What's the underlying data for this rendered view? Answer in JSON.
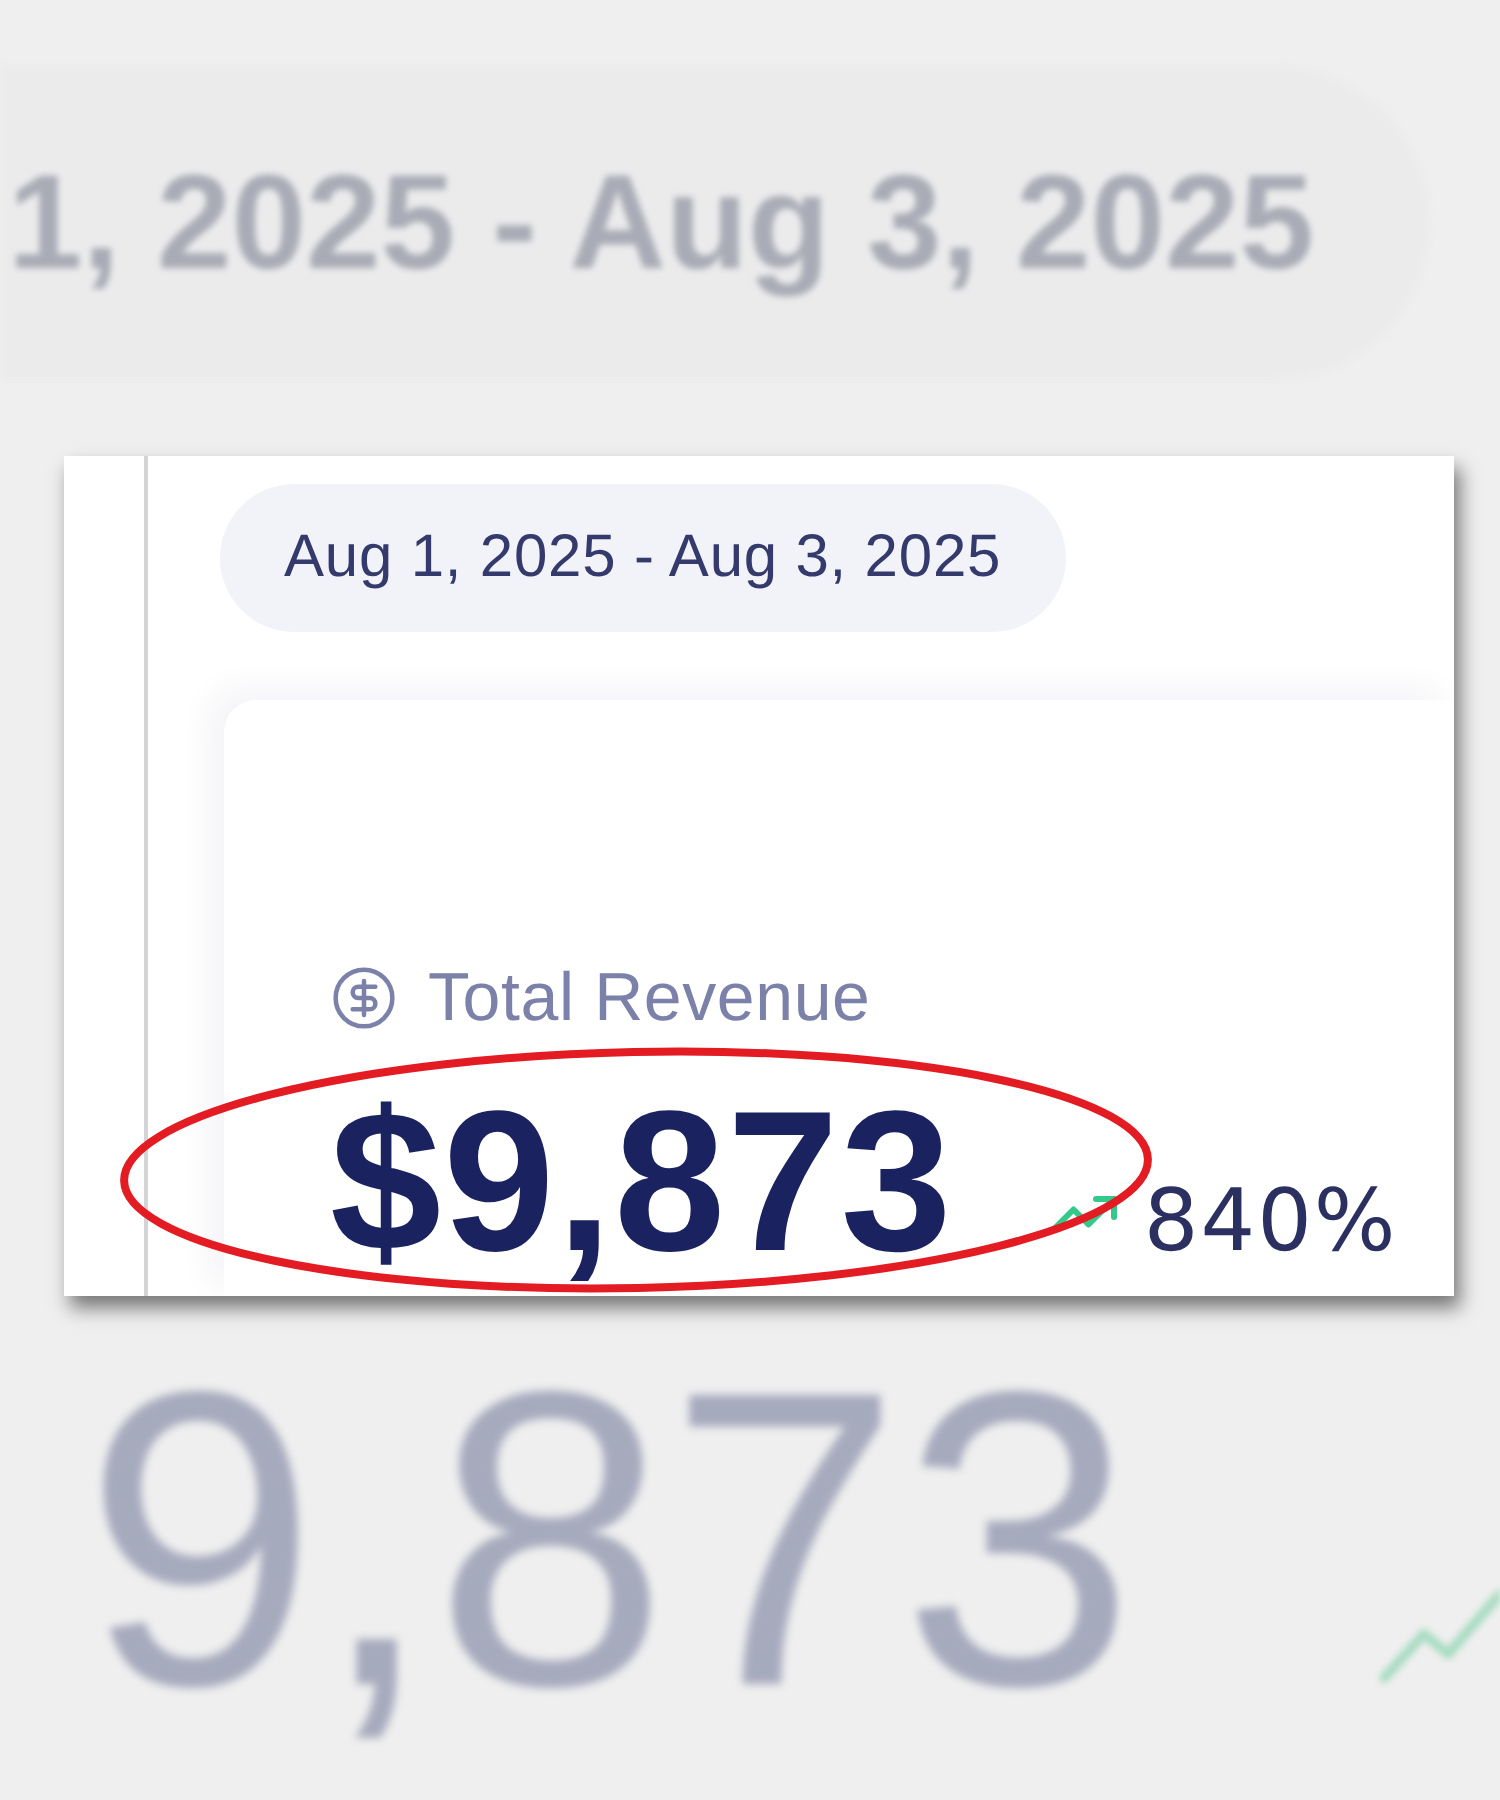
{
  "backdrop": {
    "date_range": "1, 2025 - Aug 3, 2025",
    "value": "9,873",
    "rising": true
  },
  "card": {
    "date_range": "Aug 1, 2025 - Aug 3, 2025",
    "metric": {
      "label": "Total Revenue",
      "value": "$9,873",
      "rising": true,
      "change": "840%"
    }
  },
  "annotation": {
    "kind": "ellipse"
  }
}
